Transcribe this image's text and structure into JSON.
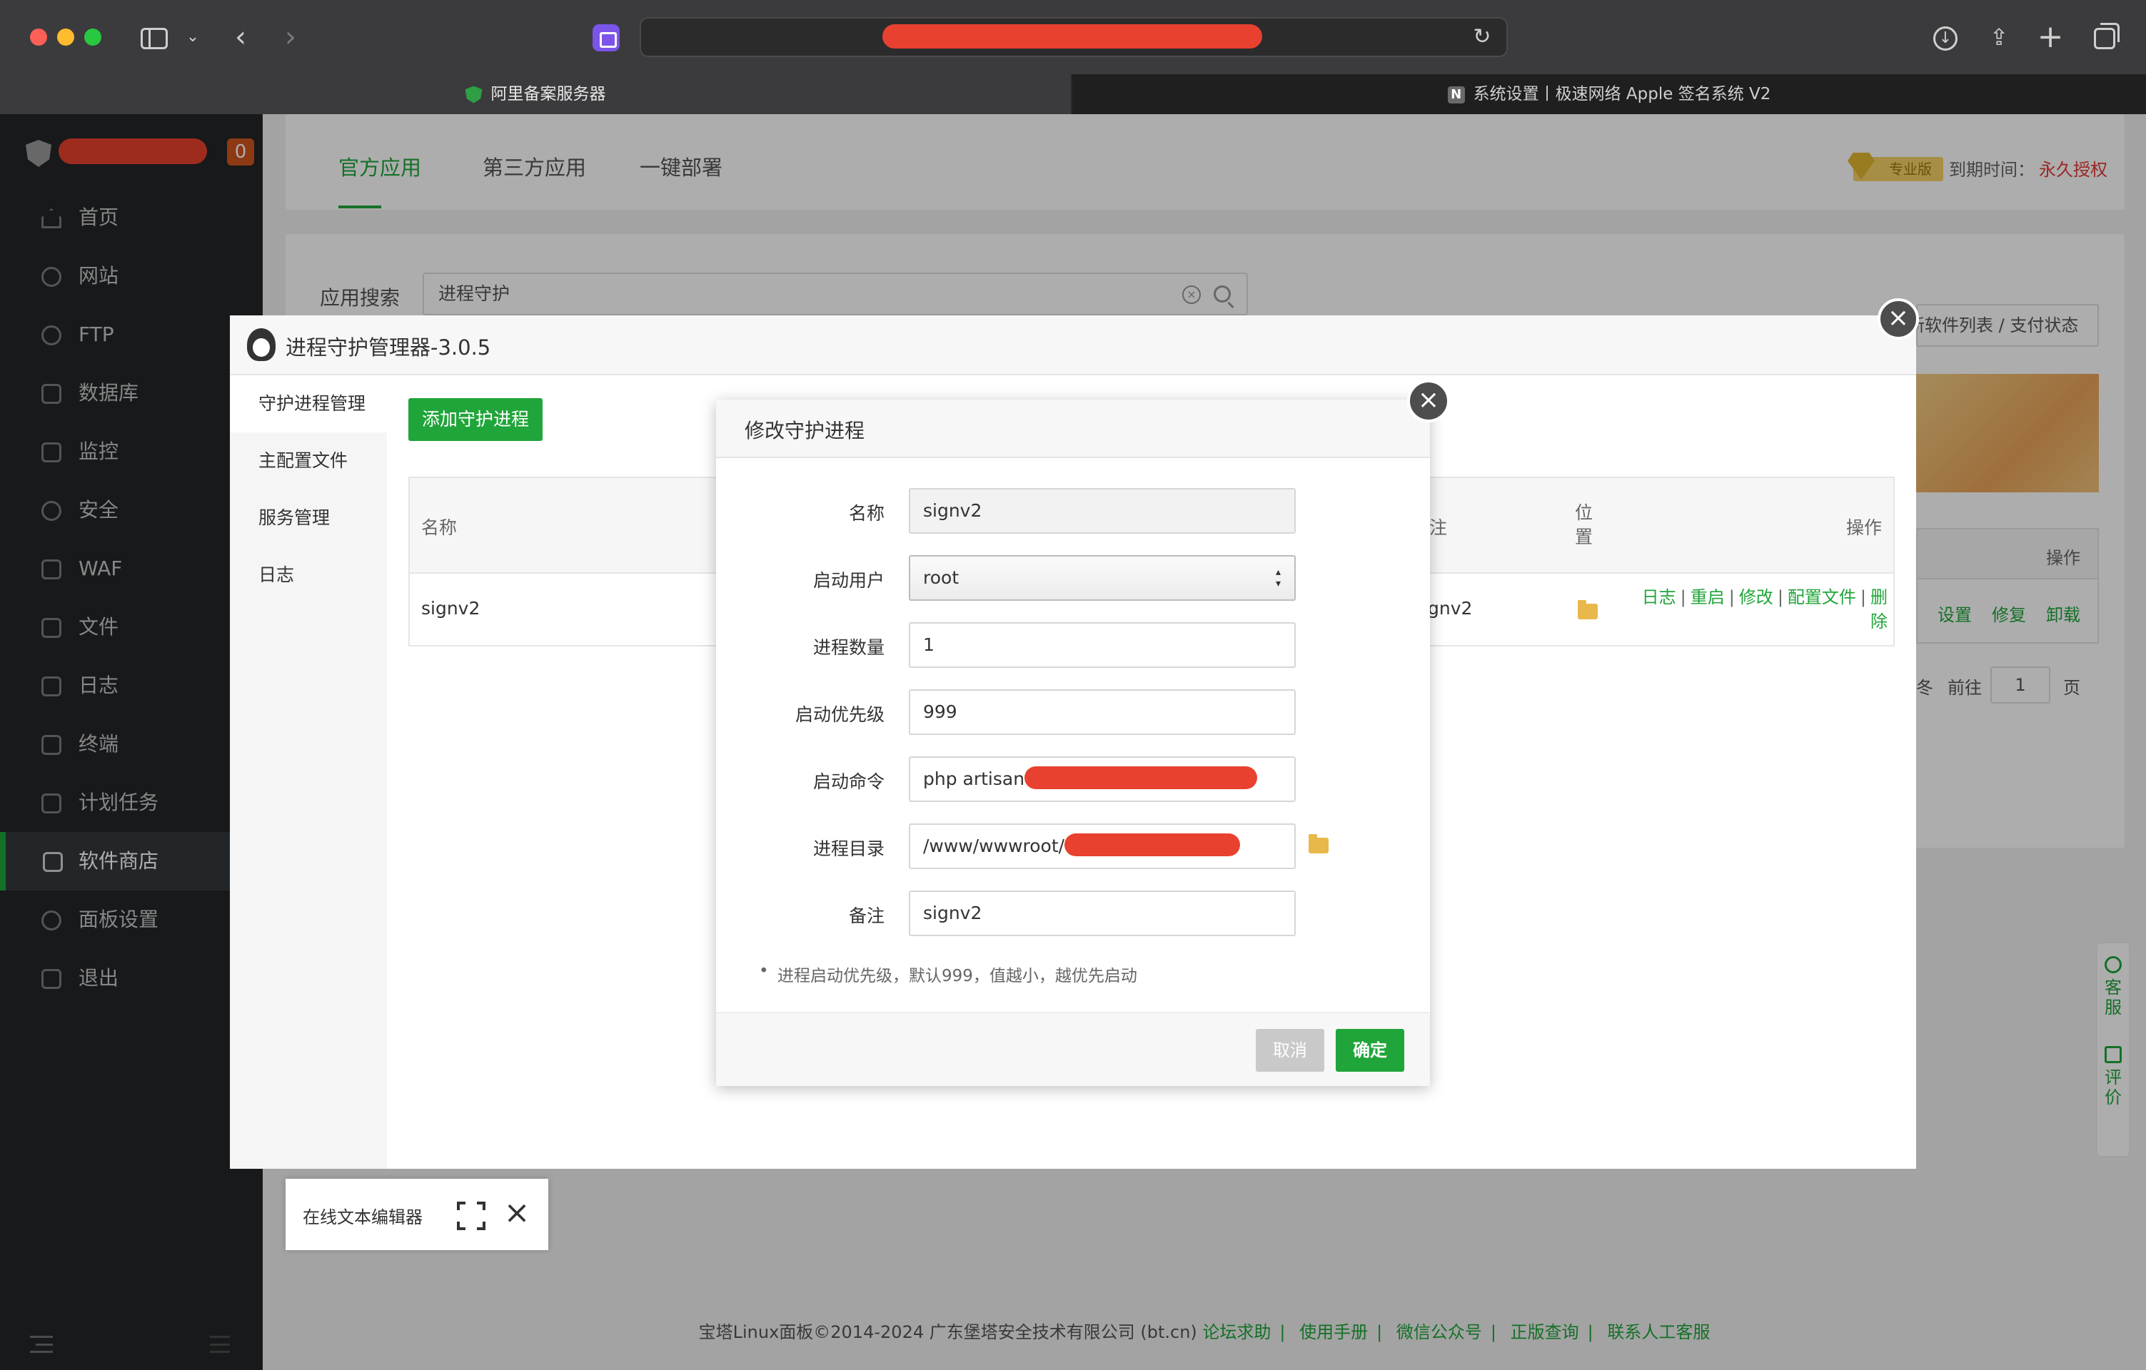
{
  "browser": {
    "tabs": [
      {
        "label": "阿里备案服务器",
        "active": true
      },
      {
        "label": "系统设置丨极速网络 Apple 签名系统 V2",
        "active": false
      }
    ]
  },
  "sidebar": {
    "badge": "0",
    "items": [
      {
        "label": "首页"
      },
      {
        "label": "网站"
      },
      {
        "label": "FTP"
      },
      {
        "label": "数据库"
      },
      {
        "label": "监控"
      },
      {
        "label": "安全"
      },
      {
        "label": "WAF"
      },
      {
        "label": "文件"
      },
      {
        "label": "日志"
      },
      {
        "label": "终端"
      },
      {
        "label": "计划任务"
      },
      {
        "label": "软件商店",
        "active": true
      },
      {
        "label": "面板设置"
      },
      {
        "label": "退出"
      }
    ]
  },
  "store": {
    "tabs": [
      "官方应用",
      "第三方应用",
      "一键部署"
    ],
    "pro_label": "专业版",
    "expire_label": "到期时间：",
    "expire_value": "永久授权",
    "search_label": "应用搜索",
    "search_value": "进程守护",
    "refresh_button": "新软件列表 / 支付状态",
    "right_table_header": "操作",
    "right_ops": [
      "设置",
      "修复",
      "卸载"
    ],
    "pager_goto": "前往",
    "pager_prefix": "冬",
    "pager_page": "1",
    "pager_suffix": "页"
  },
  "process_manager": {
    "title": "进程守护管理器-3.0.5",
    "side_items": [
      "守护进程管理",
      "主配置文件",
      "服务管理",
      "日志"
    ],
    "add_button": "添加守护进程",
    "columns": {
      "name": "名称",
      "remark_partial": "注",
      "location": "位置"
    },
    "ops_header": "操作",
    "rows": [
      {
        "name": "signv2",
        "remark_partial": "gnv2"
      }
    ],
    "row_ops": [
      "日志",
      "重启",
      "修改",
      "配置文件",
      "删除"
    ]
  },
  "edit_dialog": {
    "title": "修改守护进程",
    "fields": {
      "name": {
        "label": "名称",
        "value": "signv2"
      },
      "user": {
        "label": "启动用户",
        "value": "root"
      },
      "count": {
        "label": "进程数量",
        "value": "1"
      },
      "priority": {
        "label": "启动优先级",
        "value": "999"
      },
      "command": {
        "label": "启动命令",
        "value": "php artisan"
      },
      "directory": {
        "label": "进程目录",
        "value": "/www/wwwroot/"
      },
      "remark": {
        "label": "备注",
        "value": "signv2"
      }
    },
    "note": "进程启动优先级，默认999，值越小，越优先启动",
    "cancel": "取消",
    "confirm": "确定"
  },
  "editor_bar": {
    "label": "在线文本编辑器"
  },
  "float_panel": {
    "service": "客服",
    "review": "评价"
  },
  "footer": {
    "copyright": "宝塔Linux面板©2014-2024 广东堡塔安全技术有限公司 (bt.cn)",
    "links": [
      "论坛求助",
      "使用手册",
      "微信公众号",
      "正版查询",
      "联系人工客服"
    ]
  },
  "colors": {
    "accent": "#20a53a",
    "redaction": "#e8412f",
    "danger": "#e53935"
  }
}
